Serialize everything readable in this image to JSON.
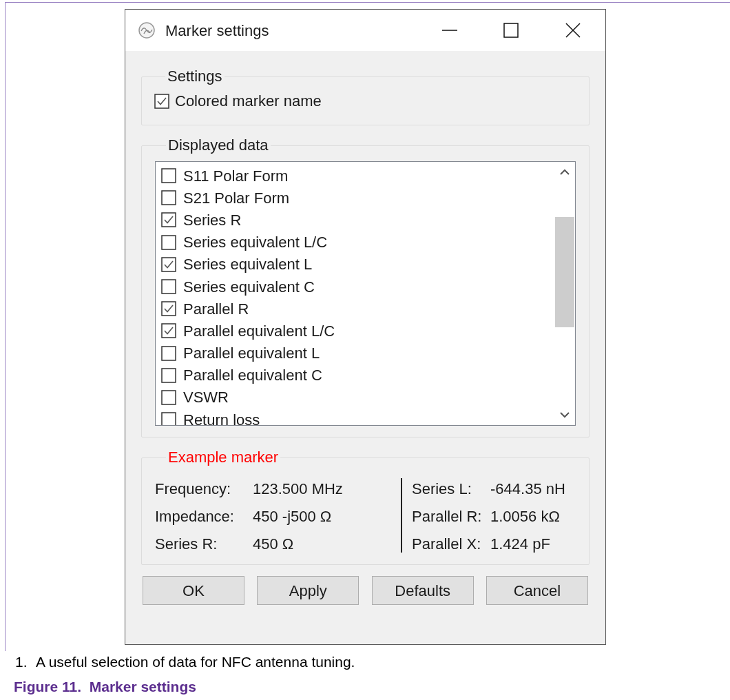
{
  "window": {
    "title": "Marker settings"
  },
  "settings": {
    "title": "Settings",
    "options": [
      {
        "label": "Colored marker name",
        "checked": true
      }
    ]
  },
  "displayed_data": {
    "title": "Displayed data",
    "items": [
      {
        "label": "S11 Polar Form",
        "checked": false
      },
      {
        "label": "S21 Polar Form",
        "checked": false
      },
      {
        "label": "Series R",
        "checked": true
      },
      {
        "label": "Series equivalent L/C",
        "checked": false
      },
      {
        "label": "Series equivalent L",
        "checked": true
      },
      {
        "label": "Series equivalent C",
        "checked": false
      },
      {
        "label": "Parallel R",
        "checked": true
      },
      {
        "label": "Parallel equivalent L/C",
        "checked": true
      },
      {
        "label": "Parallel equivalent L",
        "checked": false
      },
      {
        "label": "Parallel equivalent C",
        "checked": false
      },
      {
        "label": "VSWR",
        "checked": false
      },
      {
        "label": "Return loss",
        "checked": false
      }
    ]
  },
  "example_marker": {
    "title": "Example marker",
    "left": [
      {
        "label": "Frequency:",
        "value": "123.500 MHz"
      },
      {
        "label": "Impedance:",
        "value": "450 -j500 Ω"
      },
      {
        "label": "Series R:",
        "value": "450 Ω"
      }
    ],
    "right": [
      {
        "label": "Series L:",
        "value": "-644.35 nH"
      },
      {
        "label": "Parallel R:",
        "value": "1.0056 kΩ"
      },
      {
        "label": "Parallel X:",
        "value": "1.424 pF"
      }
    ]
  },
  "buttons": [
    "OK",
    "Apply",
    "Defaults",
    "Cancel"
  ],
  "footnote": {
    "number": "1.",
    "text": "A useful selection of data for NFC antenna tuning."
  },
  "caption": "Figure 11.  Marker settings"
}
